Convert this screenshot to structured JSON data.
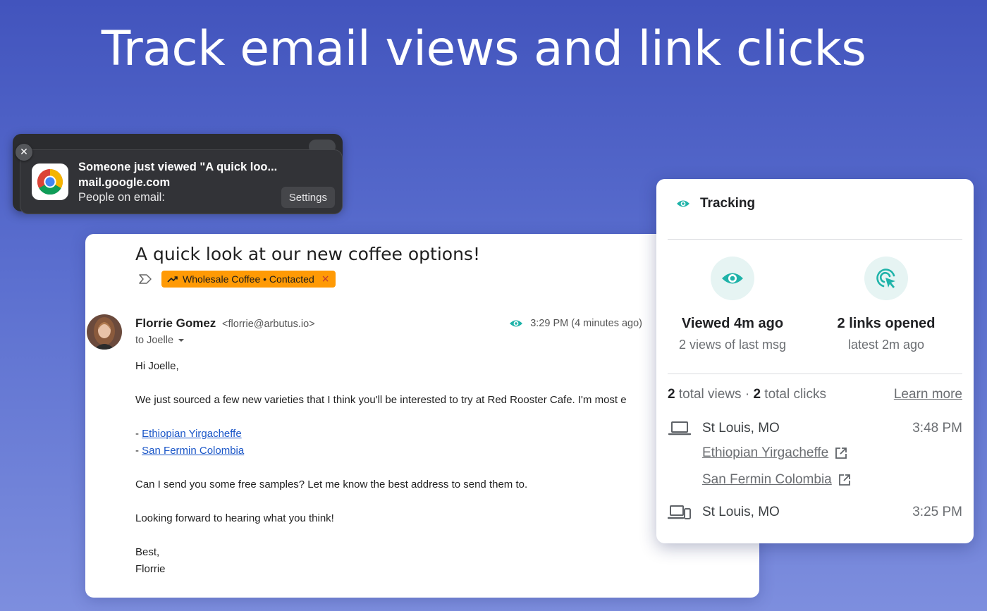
{
  "headline": "Track email views and link clicks",
  "notification": {
    "title": "Someone just viewed \"A quick loo...",
    "domain": "mail.google.com",
    "line3": "People on email:",
    "settings_label": "Settings",
    "close_glyph": "✕",
    "app_icon": "chrome-icon"
  },
  "email": {
    "subject": "A quick look at our new coffee options!",
    "tag": {
      "label": "Wholesale Coffee • Contacted",
      "color": "#ff9a05",
      "remove_glyph": "×"
    },
    "sender": {
      "name": "Florrie Gomez",
      "email": "<florrie@arbutus.io>"
    },
    "time": "3:29 PM (4 minutes ago)",
    "to": "to Joelle",
    "body": {
      "greeting": "Hi Joelle,",
      "intro": "We just sourced a few new varieties that I think you'll be interested to try at Red Rooster Cafe. I'm most e",
      "link1_prefix": "- ",
      "link1": "Ethiopian Yirgacheffe",
      "link2_prefix": "- ",
      "link2": "San Fermin Colombia",
      "question": "Can I send you some free samples? Let me know the best address to send them to.",
      "closing": "Looking forward to hearing what you think!",
      "signoff": "Best,",
      "signature": "Florrie"
    }
  },
  "tracking": {
    "title": "Tracking",
    "accent": "#1fb3a9",
    "views": {
      "main": "Viewed 4m ago",
      "sub": "2 views of last msg"
    },
    "clicks": {
      "main": "2 links opened",
      "sub": "latest 2m ago"
    },
    "total_views_count": "2",
    "total_views_label": " total views · ",
    "total_clicks_count": "2",
    "total_clicks_label": " total clicks",
    "learn_more": "Learn more",
    "events": [
      {
        "device": "laptop-icon",
        "location": "St Louis, MO",
        "time": "3:48 PM",
        "links": [
          "Ethiopian Yirgacheffe",
          "San Fermin Colombia"
        ]
      },
      {
        "device": "devices-icon",
        "location": "St Louis, MO",
        "time": "3:25 PM"
      }
    ]
  }
}
